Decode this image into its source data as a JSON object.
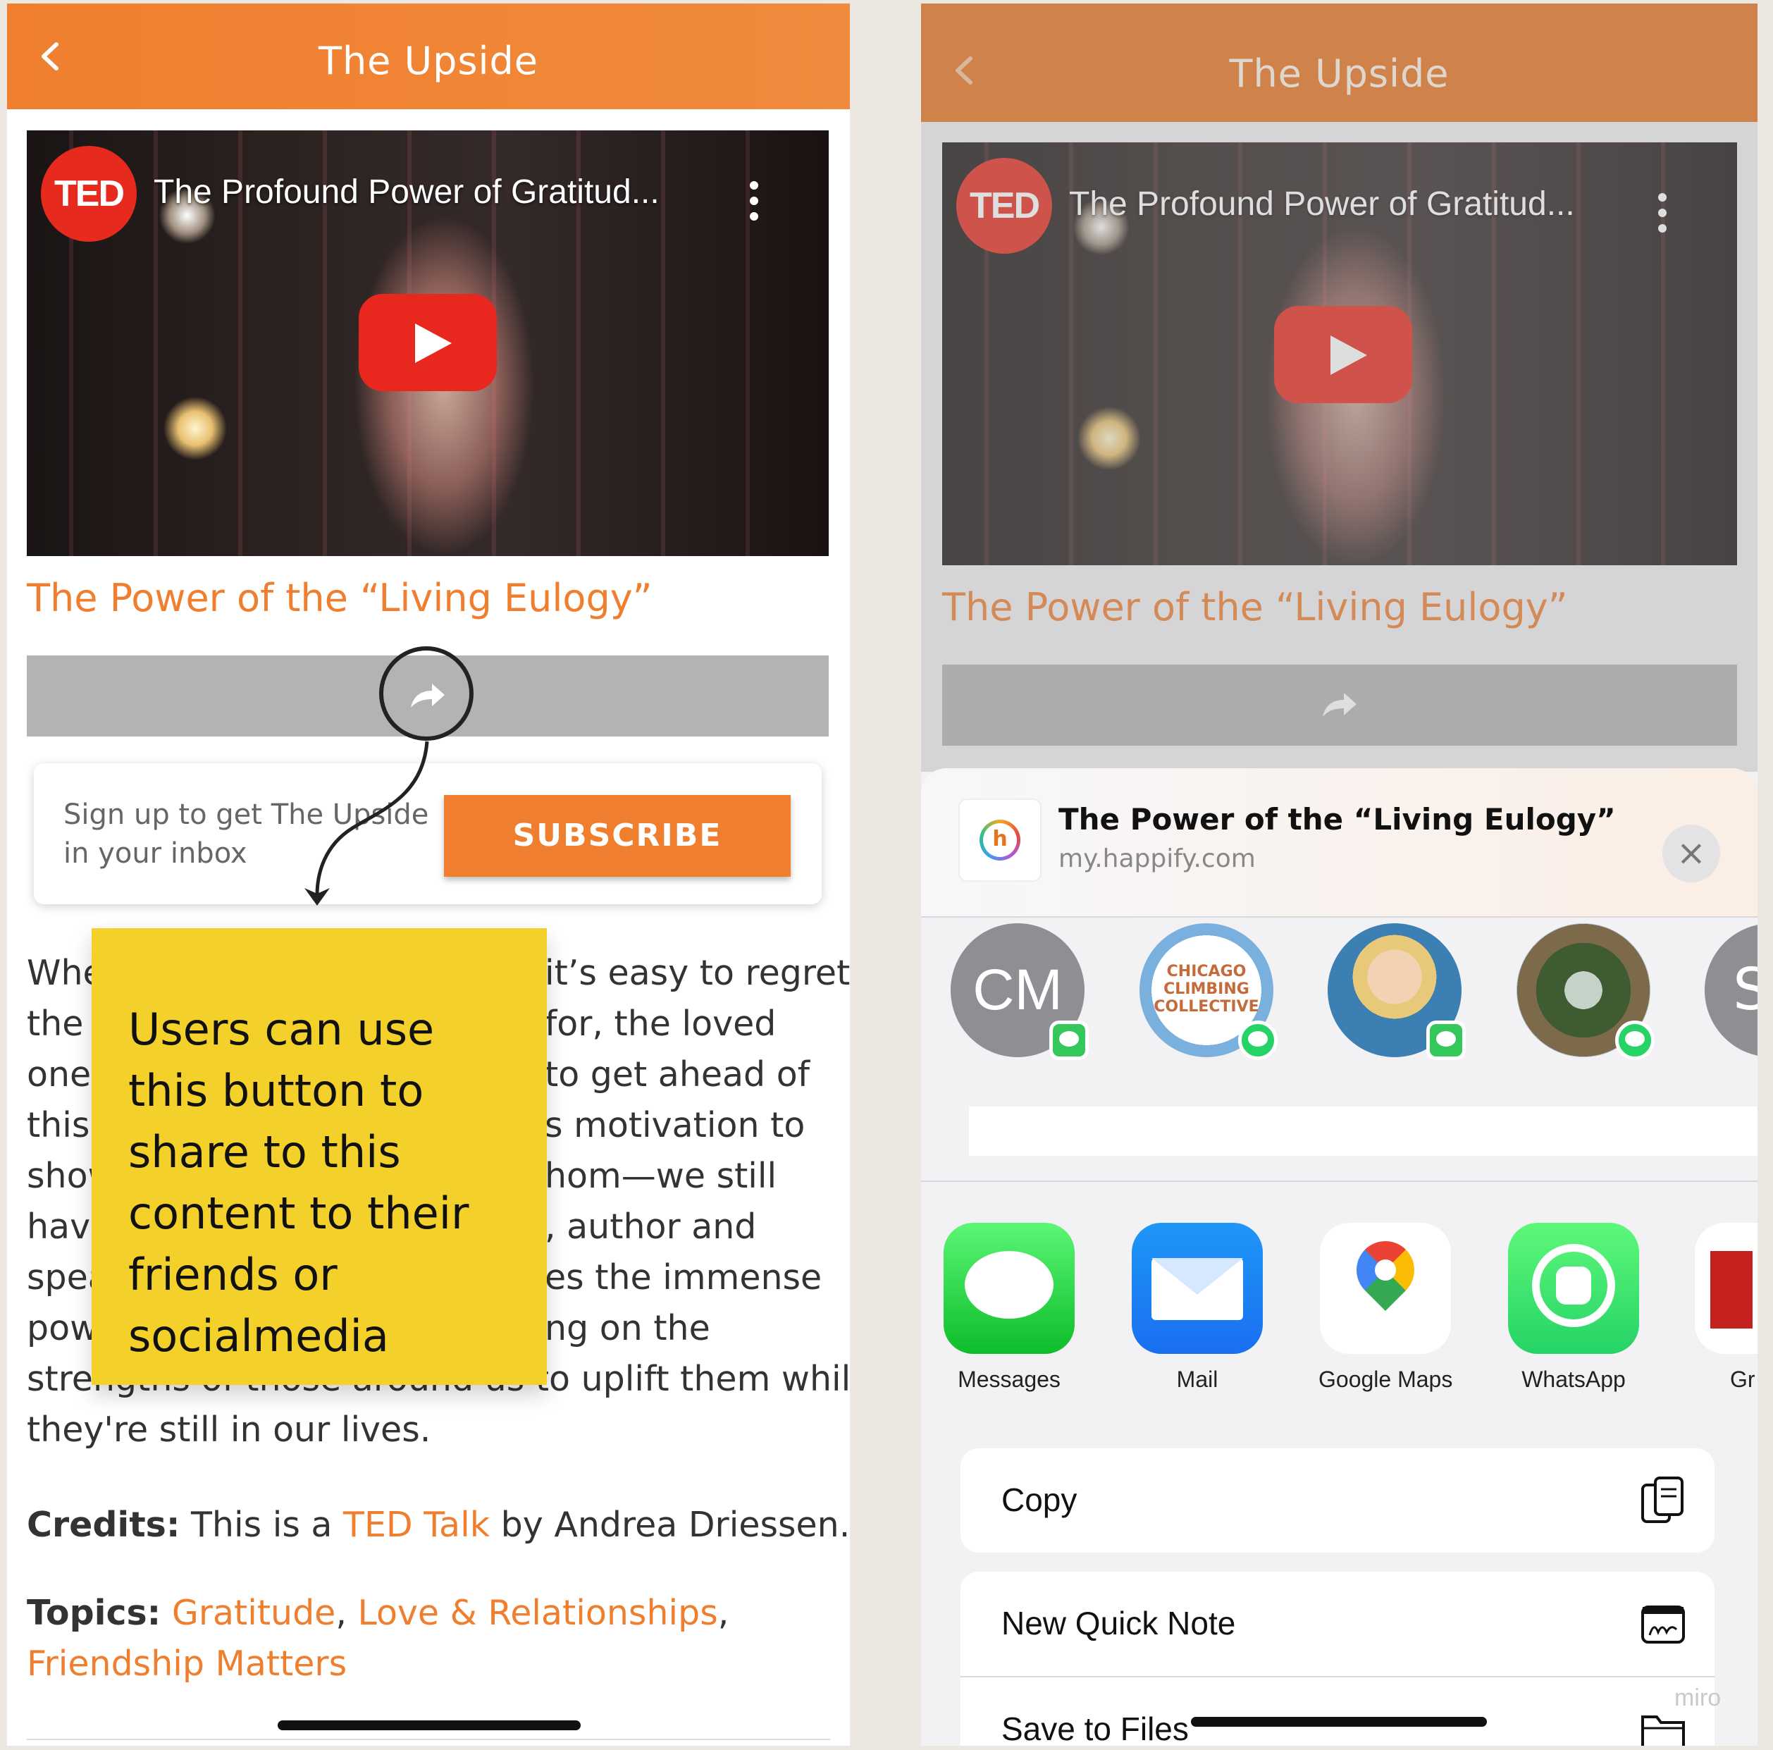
{
  "left_screen": {
    "header": {
      "title": "The Upside",
      "back_icon": "chevron-left-icon"
    },
    "video": {
      "channel_logo": "TED",
      "title": "The Profound Power of Gratitud..."
    },
    "article_title": "The Power of the “Living Eulogy”",
    "share_icon": "share-arrow-icon",
    "subscribe": {
      "prompt_line1": "Sign up to get The Upside",
      "prompt_line2": "in your inbox",
      "button_label": "SUBSCRIBE"
    },
    "body": {
      "lines": [
        "Whe",
        "the",
        "one",
        "this",
        "show",
        "have",
        "spea",
        "pow",
        "strengths of those around us to uplift them while",
        "they're still in our lives."
      ],
      "right_fragments": [
        "it’s easy to regret",
        "for, the loved",
        "to get ahead of",
        "s motivation to",
        "hom—we still",
        ", author and",
        "es the immense",
        "ng on the"
      ]
    },
    "credits": {
      "label": "Credits:",
      "prefix": "This is a",
      "link": "TED Talk",
      "suffix": "by Andrea Driessen."
    },
    "topics": {
      "label": "Topics:",
      "items": [
        "Gratitude",
        "Love & Relationships",
        "Friendship Matters"
      ],
      "separator": ","
    }
  },
  "annotation": {
    "sticky_note_text": "Users can use this button to share to this content to their friends or socialmedia",
    "sticky_color": "#f4d12a"
  },
  "right_screen": {
    "header": {
      "title": "The Upside",
      "back_icon": "chevron-left-icon"
    },
    "video": {
      "channel_logo": "TED",
      "title": "The Profound Power of Gratitud..."
    },
    "article_title": "The Power of the “Living Eulogy”",
    "share_sheet": {
      "title": "The Power of the “Living Eulogy”",
      "url": "my.happify.com",
      "close_icon": "close-icon",
      "people": [
        {
          "initials": "CM",
          "badge": "messages"
        },
        {
          "label": "CHICAGO CLIMBING COLLECTIVE",
          "badge": "whatsapp"
        },
        {
          "badge": "messages"
        },
        {
          "badge": "whatsapp"
        },
        {
          "initials": "S"
        }
      ],
      "apps": [
        {
          "label": "Messages",
          "icon": "messages-icon"
        },
        {
          "label": "Mail",
          "icon": "mail-icon"
        },
        {
          "label": "Google Maps",
          "icon": "google-maps-icon"
        },
        {
          "label": "WhatsApp",
          "icon": "whatsapp-icon"
        },
        {
          "label": "Gr",
          "icon": "gmail-icon"
        }
      ],
      "actions": [
        {
          "label": "Copy",
          "icon": "copy-icon"
        },
        {
          "label": "New Quick Note",
          "icon": "quick-note-icon"
        },
        {
          "label": "Save to Files",
          "icon": "folder-icon"
        }
      ]
    }
  },
  "watermark": "miro",
  "colors": {
    "brand_orange": "#ef7f2e",
    "header_orange_dark": "#e8731c",
    "share_bar_gray": "#b3b3b3"
  }
}
